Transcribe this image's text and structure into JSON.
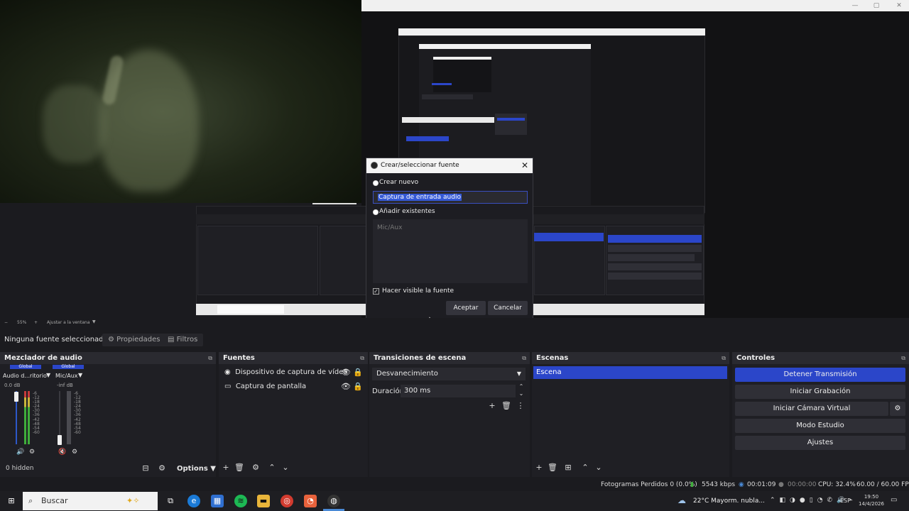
{
  "dialog": {
    "title": "Crear/seleccionar fuente",
    "create_new_label": "Crear nuevo",
    "name_value": "Captura de entrada audio",
    "add_existing_label": "Añadir existentes",
    "existing_item": "Mic/Aux",
    "visible_label": "Hacer visible la fuente",
    "accept": "Aceptar",
    "cancel": "Cancelar"
  },
  "zoom": {
    "value": "55%",
    "fit": "Ajustar a la ventana"
  },
  "source_bar": {
    "no_source": "Ninguna fuente seleccionad",
    "properties": "Propiedades",
    "filters": "Filtros"
  },
  "mixer": {
    "title": "Mezclador de audio",
    "channels": [
      {
        "global": "Global",
        "name": "Audio d...ritorio",
        "db": "0.0 dB",
        "level": 0.78
      },
      {
        "global": "Global",
        "name": "Mic/Aux",
        "db": "-inf dB",
        "level": 0.12
      }
    ],
    "scale": [
      "-6",
      "-12",
      "-18",
      "-24",
      "-30",
      "-36",
      "-42",
      "-48",
      "-54",
      "-60"
    ],
    "hidden": "0 hidden",
    "options": "Options"
  },
  "sources": {
    "title": "Fuentes",
    "items": [
      "Dispositivo de captura de vídeo",
      "Captura de pantalla"
    ]
  },
  "transitions": {
    "title": "Transiciones de escena",
    "selected": "Desvanecimiento",
    "duration_label": "Duración",
    "duration_value": "300 ms"
  },
  "scenes": {
    "title": "Escenas",
    "items": [
      "Escena"
    ]
  },
  "controls": {
    "title": "Controles",
    "buttons": [
      "Detener Transmisión",
      "Iniciar Grabación",
      "Iniciar Cámara Virtual",
      "Modo Estudio",
      "Ajustes"
    ]
  },
  "status": {
    "dropped": "Fotogramas Perdidos 0 (0.0%)",
    "bitrate": "5543 kbps",
    "stream_time": "00:01:09",
    "rec_time": "00:00:00",
    "cpu": "CPU: 32.4%",
    "fps": "60.00 / 60.00 FPS"
  },
  "taskbar": {
    "search": "Buscar",
    "weather": "22°C  Mayorm. nubla...",
    "lang": "ESP",
    "time": "19:50",
    "date": "14/4/2026"
  },
  "colors": {
    "accent": "#2b46c9",
    "panel": "#1f1f24",
    "bg": "#1b1b1f"
  }
}
